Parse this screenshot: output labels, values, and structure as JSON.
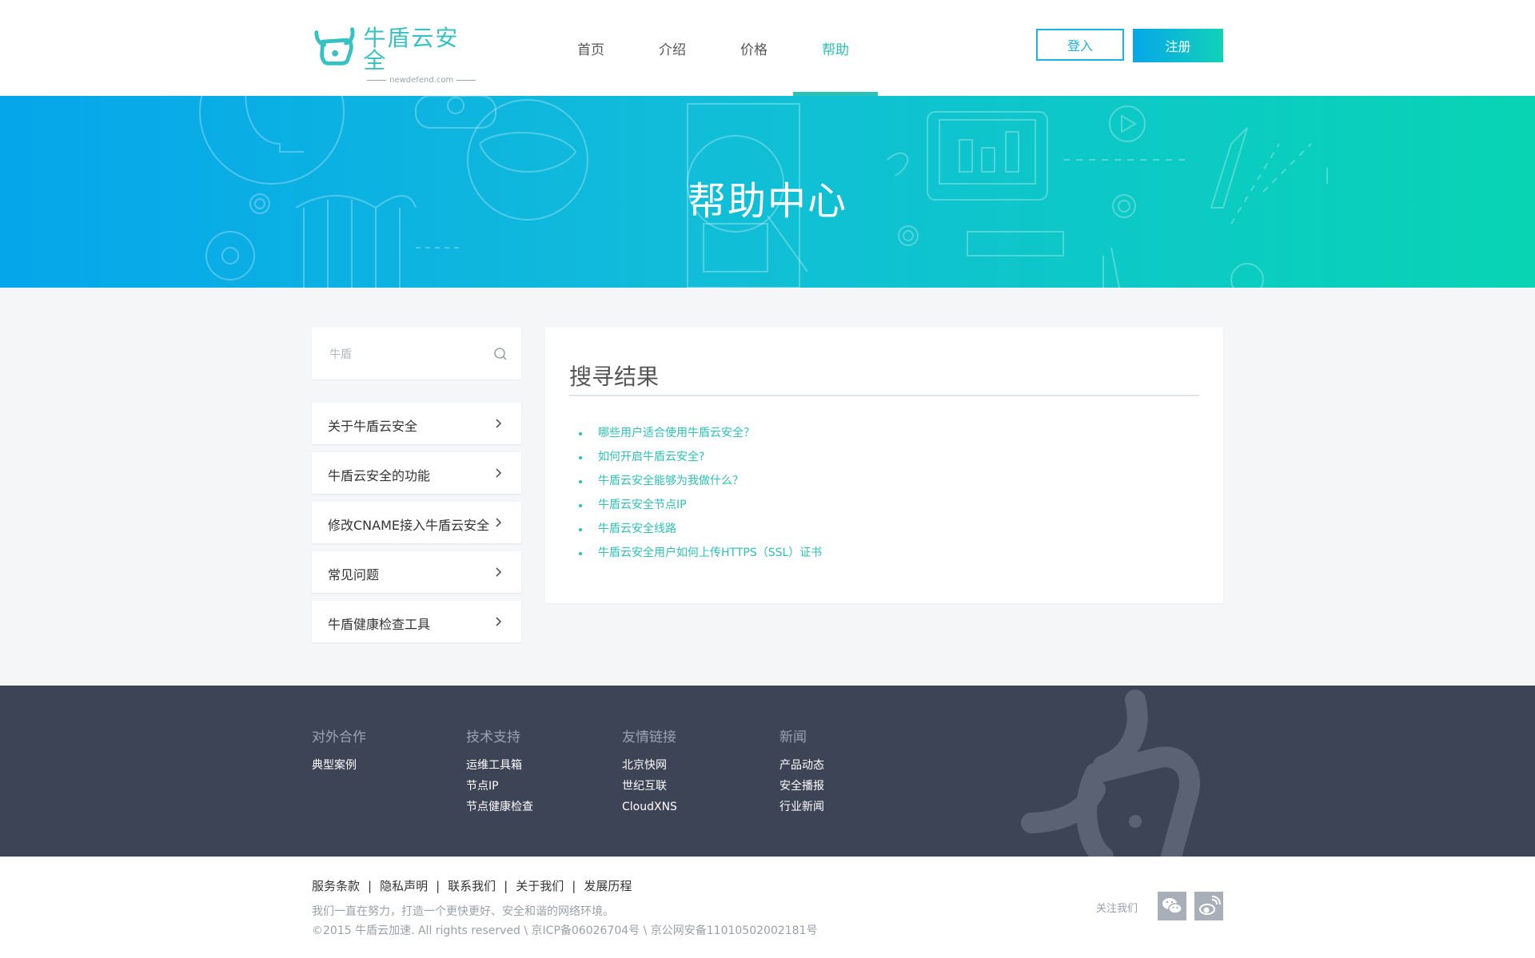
{
  "header": {
    "logo": {
      "title": "牛盾云安全",
      "subtitle": "newdefend.com"
    },
    "nav": [
      {
        "label": "首页",
        "active": false
      },
      {
        "label": "介绍",
        "active": false
      },
      {
        "label": "价格",
        "active": false
      },
      {
        "label": "帮助",
        "active": true
      }
    ],
    "login_label": "登入",
    "register_label": "注册"
  },
  "banner": {
    "title": "帮助中心"
  },
  "sidebar": {
    "search": {
      "value": "",
      "placeholder": "牛盾"
    },
    "items": [
      {
        "label": "关于牛盾云安全"
      },
      {
        "label": "牛盾云安全的功能"
      },
      {
        "label": "修改CNAME接入牛盾云安全"
      },
      {
        "label": "常见问题"
      },
      {
        "label": "牛盾健康检查工具"
      }
    ]
  },
  "main": {
    "title": "搜寻结果",
    "results": [
      "哪些用户适合使用牛盾云安全？",
      "如何开启牛盾云安全?",
      "牛盾云安全能够为我做什么？",
      "牛盾云安全节点IP",
      "牛盾云安全线路",
      "牛盾云安全用户如何上传HTTPS（SSL）证书"
    ]
  },
  "footer": {
    "columns": [
      {
        "heading": "对外合作",
        "links": [
          "典型案例"
        ]
      },
      {
        "heading": "技术支持",
        "links": [
          "运维工具箱",
          "节点IP",
          "节点健康检查"
        ]
      },
      {
        "heading": "友情链接",
        "links": [
          "北京快网",
          "世纪互联",
          "CloudXNS"
        ]
      },
      {
        "heading": "新闻",
        "links": [
          "产品动态",
          "安全播报",
          "行业新闻"
        ]
      }
    ]
  },
  "bottom": {
    "links": [
      "服务条款",
      "隐私声明",
      "联系我们",
      "关于我们",
      "发展历程"
    ],
    "slogan": "我们一直在努力，打造一个更快更好、安全和谐的网络环境。",
    "copyright": "©2015 牛盾云加速. All rights reserved \\ 京ICP备06026704号 \\ 京公网安备11010502002181号",
    "follow_label": "关注我们",
    "social_icons": [
      "wechat-icon",
      "weibo-icon"
    ]
  },
  "colors": {
    "accent": "#2bc1b5",
    "login_border": "#1bb3e0",
    "footer_bg": "#3d4456",
    "page_bg": "#f5f6f8"
  }
}
